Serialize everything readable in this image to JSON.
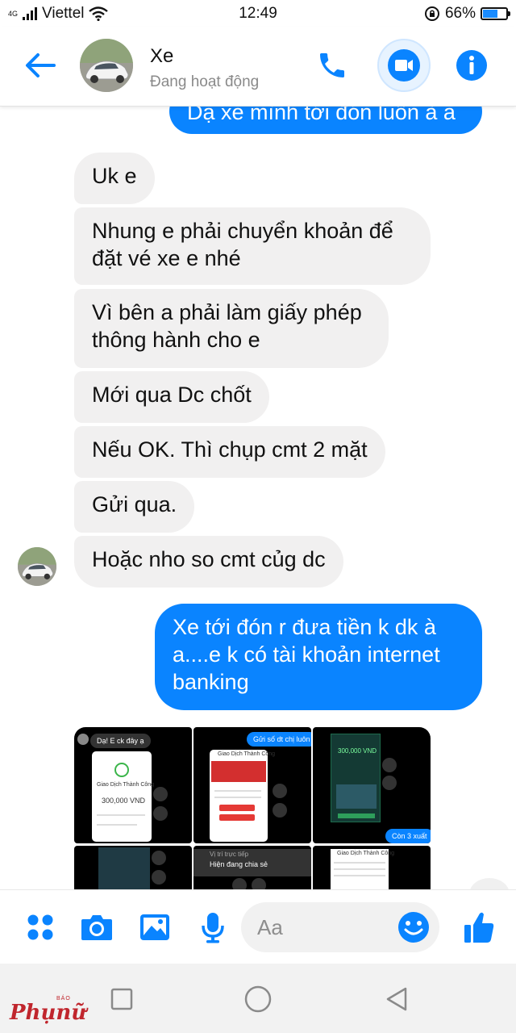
{
  "status_bar": {
    "network_type": "4G",
    "carrier": "Viettel",
    "time": "12:49",
    "battery": "66%",
    "battery_level": 0.66
  },
  "header": {
    "contact_name": "Xe",
    "contact_status": "Đang hoạt động",
    "accent_color": "#0a84ff",
    "icons": [
      "back-arrow-icon",
      "phone-icon",
      "video-camera-icon",
      "info-icon"
    ]
  },
  "messages": [
    {
      "from": "me",
      "text": "Dạ xe mình tới đón luôn à a"
    },
    {
      "from": "contact",
      "text": "Uk e"
    },
    {
      "from": "contact",
      "text": "Nhung e phải chuyển  khoản để\nđặt vé xe e nhé"
    },
    {
      "from": "contact",
      "text": "Vì bên a phải làm giấy phép\nthông hành cho e"
    },
    {
      "from": "contact",
      "text": "Mới qua Dc chốt"
    },
    {
      "from": "contact",
      "text": "Nếu OK. Thì chụp cmt 2 mặt"
    },
    {
      "from": "contact",
      "text": "Gửi qua."
    },
    {
      "from": "contact",
      "text": "Hoặc nho so cmt củg dc"
    },
    {
      "from": "me",
      "text": "Xe tới đón r đưa tiền k dk à\na....e k có tài khoản internet\nbanking"
    }
  ],
  "photo_grid": {
    "photo1": {
      "caption": "Dạ! E ck đây ạ",
      "title": "Giao Dịch Thành Công",
      "amount": "300,000 VND"
    },
    "photo2": {
      "caption": "Gửi số dt chị luôn",
      "title": "Giao Dịch Thành Công"
    },
    "photo3": {
      "amount": "300,000 VND",
      "caption": "Còn 3 xuất"
    },
    "photo5": {
      "line1": "Vị trí trực tiếp",
      "line2": "Hiện đang chia sẻ"
    },
    "photo6": {
      "title": "Giao Dịch Thành Công"
    }
  },
  "composer": {
    "placeholder": "Aa",
    "icons": [
      "apps-grid-icon",
      "camera-icon",
      "gallery-icon",
      "microphone-icon",
      "emoji-icon",
      "thumbs-up-icon"
    ]
  },
  "nav_bar": {
    "watermark_small": "BÁO",
    "watermark": "Phụnữ"
  }
}
